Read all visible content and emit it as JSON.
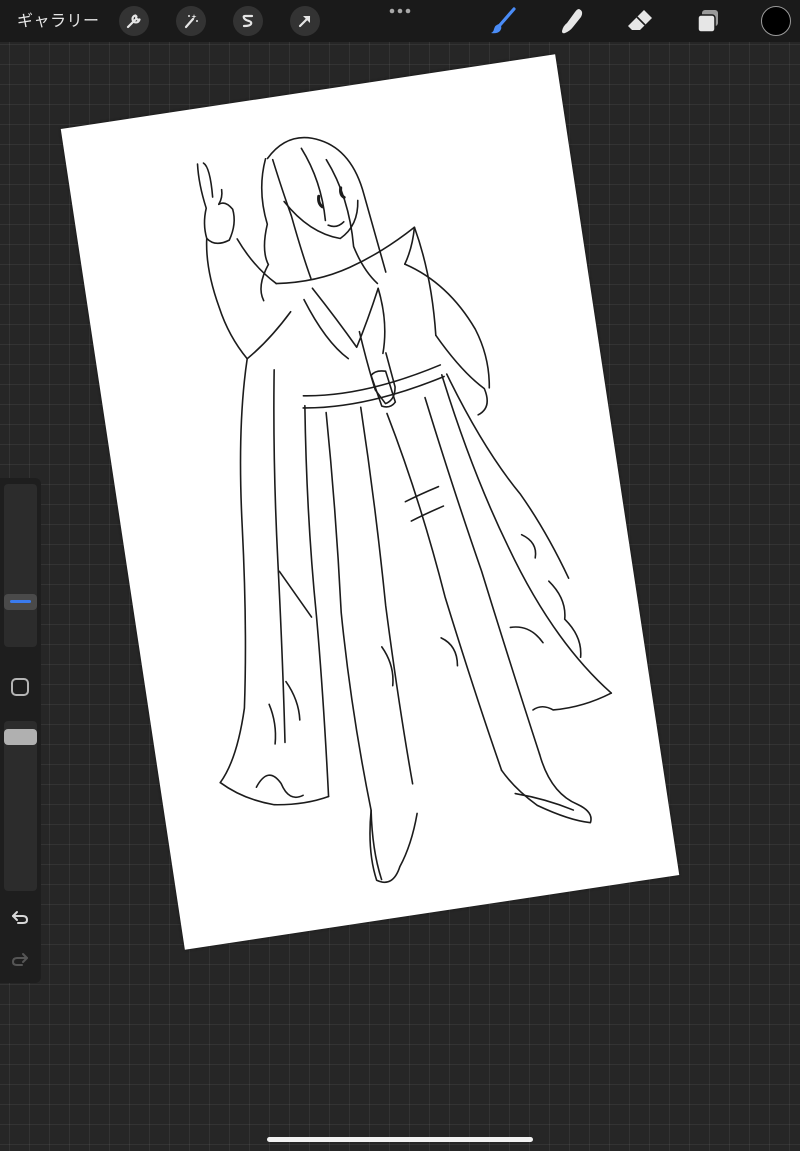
{
  "topbar": {
    "gallery_label": "ギャラリー",
    "tools_left": [
      {
        "name": "actions",
        "icon": "wrench-icon"
      },
      {
        "name": "adjustments",
        "icon": "magic-wand-icon"
      },
      {
        "name": "selection",
        "icon": "selection-s-icon"
      },
      {
        "name": "transform",
        "icon": "arrow-cursor-icon"
      }
    ],
    "more_icon": "ellipsis-icon",
    "tools_right": [
      {
        "name": "brush",
        "icon": "brush-icon",
        "active": true
      },
      {
        "name": "smudge",
        "icon": "smudge-finger-icon",
        "active": false
      },
      {
        "name": "eraser",
        "icon": "eraser-icon",
        "active": false
      },
      {
        "name": "layers",
        "icon": "layers-icon",
        "active": false
      }
    ],
    "current_color": "#000000",
    "active_tool_color": "#4a8cf7"
  },
  "canvas": {
    "background": "#ffffff",
    "content": "sketch"
  },
  "sidebar": {
    "brush_size_level": 0.25,
    "opacity_level": 0.95,
    "size_thumb_color": "#3a7bef",
    "opacity_thumb_color": "#b0b0b0",
    "modify_icon": "square-modify-icon",
    "undo_icon": "undo-arrow-icon",
    "redo_icon": "redo-arrow-icon",
    "redo_enabled": false
  },
  "colors": {
    "toolbar_bg": "#1a1a1a",
    "workspace_bg": "#262626",
    "icon_light": "#e6e6e6",
    "accent": "#4a8cf7"
  }
}
